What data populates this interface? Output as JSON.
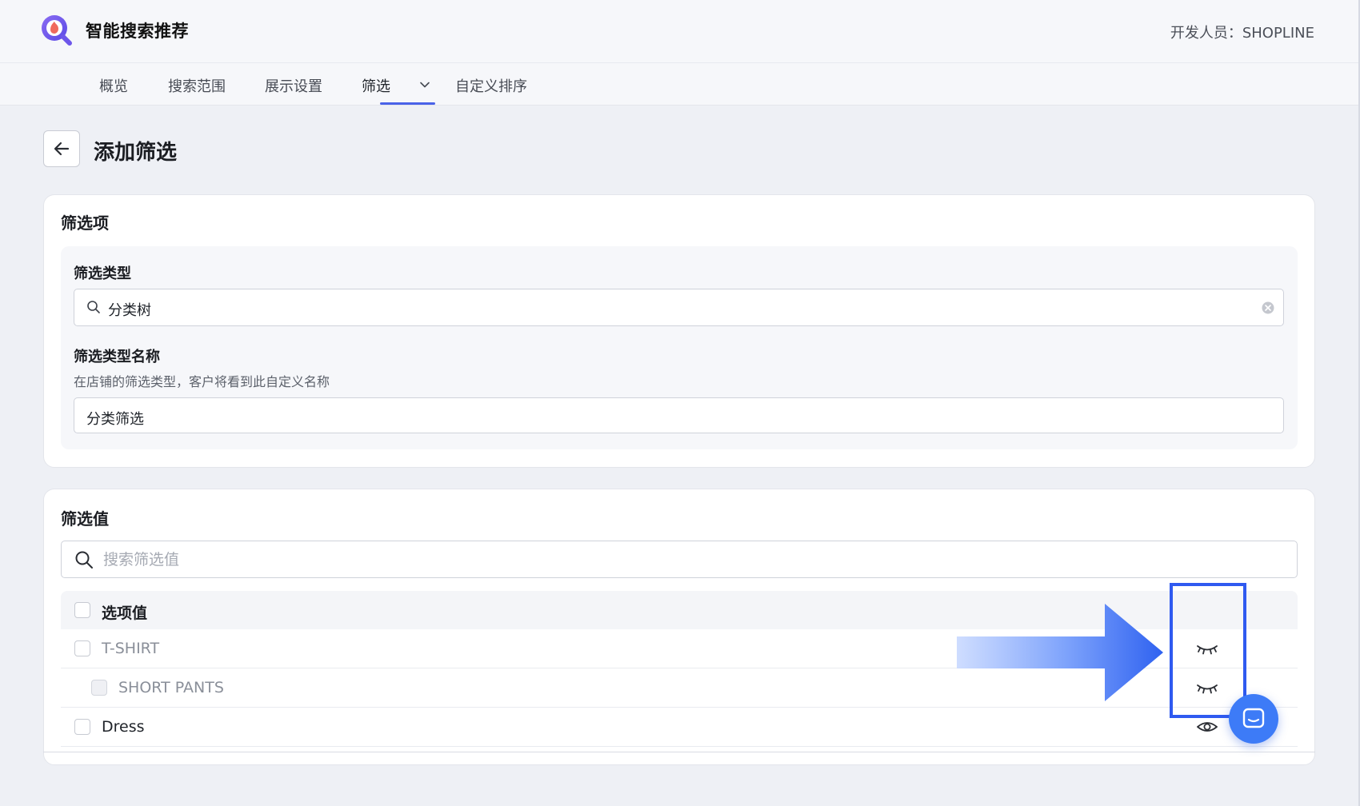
{
  "app": {
    "title": "智能搜索推荐",
    "developer": "开发人员：SHOPLINE"
  },
  "tabs": [
    {
      "label": "概览"
    },
    {
      "label": "搜索范围"
    },
    {
      "label": "展示设置"
    },
    {
      "label": "筛选"
    },
    {
      "label": "自定义排序"
    }
  ],
  "page": {
    "title": "添加筛选"
  },
  "filter_item": {
    "section_title": "筛选项",
    "type_label": "筛选类型",
    "type_value": "分类树",
    "name_label": "筛选类型名称",
    "name_help": "在店铺的筛选类型，客户将看到此自定义名称",
    "name_value": "分类筛选"
  },
  "filter_values": {
    "section_title": "筛选值",
    "search_placeholder": "搜索筛选值",
    "header_label": "选项值",
    "rows": [
      {
        "label": "T-SHIRT",
        "visibility": "hidden-eye-icon"
      },
      {
        "label": "SHORT PANTS",
        "visibility": "hidden-eye-icon"
      },
      {
        "label": "Dress",
        "visibility": "eye-icon"
      }
    ]
  },
  "colors": {
    "accent": "#4a62e8",
    "highlight": "#2f5af0",
    "chat": "#3d7bf7"
  }
}
